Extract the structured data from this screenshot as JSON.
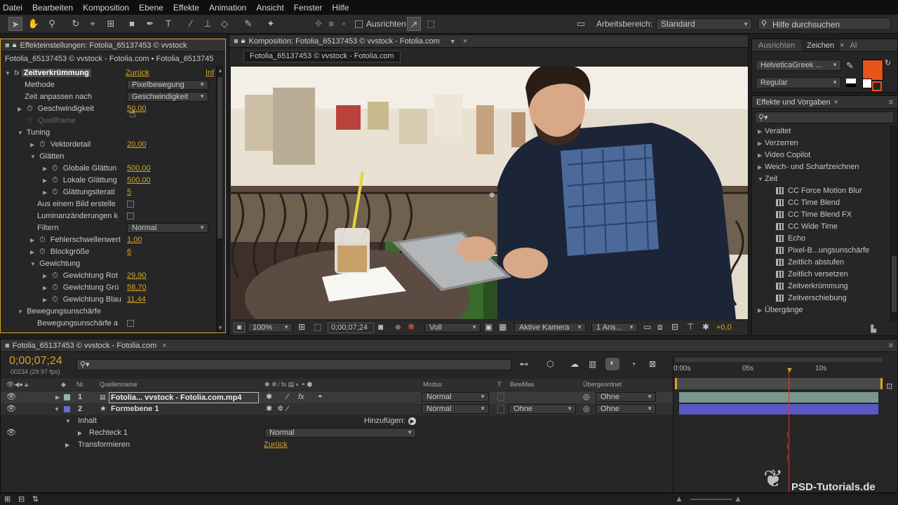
{
  "menu": [
    "Datei",
    "Bearbeiten",
    "Komposition",
    "Ebene",
    "Effekte",
    "Animation",
    "Ansicht",
    "Fenster",
    "Hilfe"
  ],
  "toolbar": {
    "ausrichten": "Ausrichten",
    "arbeitsbereich_label": "Arbeitsbereich:",
    "arbeitsbereich_value": "Standard",
    "search_placeholder": "Hilfe durchsuchen"
  },
  "effects_panel": {
    "tab": "Effekteinstellungen: Fotolia_65137453 © vvstock",
    "breadcrumb": "Fotolia_65137453 © vvstock - Fotolia.com • Fotolia_6513745",
    "effect_name": "Zeitverkrümmung",
    "reset": "Zurück",
    "info_cut": "Inf",
    "rows": [
      {
        "label": "Methode",
        "dd": "Pixelbewegung"
      },
      {
        "label": "Zeit anpassen nach",
        "dd": "Geschwindigkeit"
      },
      {
        "label": "Geschwindigkeit",
        "val": "50,00"
      },
      {
        "label": "Quellframe"
      },
      {
        "label": "Tuning"
      },
      {
        "label": "Vektordetail",
        "val": "20,00"
      },
      {
        "label": "Glätten"
      },
      {
        "label": "Globale Glättun",
        "val": "500,00"
      },
      {
        "label": "Lokale Glättung",
        "val": "500,00"
      },
      {
        "label": "Glättungsiterati",
        "val": "5"
      },
      {
        "label": "Aus einem Bild erstelle"
      },
      {
        "label": "Luminanzänderungen k"
      },
      {
        "label": "Filtern",
        "dd": "Normal"
      },
      {
        "label": "Fehlerschwellenwert",
        "val": "1,00"
      },
      {
        "label": "Blockgröße",
        "val": "6"
      },
      {
        "label": "Gewichtung"
      },
      {
        "label": "Gewichtung Rot",
        "val": "29,90"
      },
      {
        "label": "Gewichtung Grü",
        "val": "58,70"
      },
      {
        "label": "Gewichtung Blau",
        "val": "11,44"
      },
      {
        "label": "Bewegungsunschärfe"
      },
      {
        "label": "Bewegungsunschärfe a"
      }
    ]
  },
  "comp_panel": {
    "tab": "Komposition: Fotolia_65137453 © vvstock - Fotolia.com",
    "subtab": "Fotolia_65137453 © vvstock - Fotolia.com",
    "zoom": "100%",
    "timecode": "0;00;07;24",
    "resolution": "Voll",
    "camera": "Aktive Kamera",
    "views": "1 Ans...",
    "exposure": "+0,0"
  },
  "char_panel": {
    "tabs": [
      "Ausrichten",
      "Zeichen",
      "Al"
    ],
    "font": "HelveticaGreek ...",
    "style": "Regular",
    "fill_color": "#e8541a"
  },
  "effects_presets": {
    "tab": "Effekte und Vorgaben",
    "search_placeholder": "",
    "items": [
      {
        "label": "Veraltet",
        "type": "folder"
      },
      {
        "label": "Verzerren",
        "type": "folder"
      },
      {
        "label": "Video Copilot",
        "type": "folder"
      },
      {
        "label": "Weich- und Scharfzeichnen",
        "type": "folder"
      },
      {
        "label": "Zeit",
        "type": "folder-open"
      },
      {
        "label": "CC Force Motion Blur",
        "type": "effect"
      },
      {
        "label": "CC Time Blend",
        "type": "effect"
      },
      {
        "label": "CC Time Blend FX",
        "type": "effect"
      },
      {
        "label": "CC Wide Time",
        "type": "effect"
      },
      {
        "label": "Echo",
        "type": "effect"
      },
      {
        "label": "Pixel-B...ungsunschärfe",
        "type": "effect"
      },
      {
        "label": "Zeitlich abstufen",
        "type": "effect"
      },
      {
        "label": "Zeitlich versetzen",
        "type": "effect"
      },
      {
        "label": "Zeitverkrümmung",
        "type": "effect"
      },
      {
        "label": "Zeitverschiebung",
        "type": "effect"
      },
      {
        "label": "Übergänge",
        "type": "folder"
      }
    ]
  },
  "timeline": {
    "tab": "Fotolia_65137453 © vvstock - Fotolia.com",
    "timecode": "0;00;07;24",
    "frames": "00234 (29.97 fps)",
    "col_nr": "Nr.",
    "col_source": "Quellenname",
    "col_mode": "Modus",
    "col_t": "T",
    "col_bewmas": "BewMas",
    "col_parent": "Übergeordnet",
    "ruler": [
      "0:00s",
      "05s",
      "10s"
    ],
    "layers": [
      {
        "nr": "1",
        "name": "Fotolia... vvstock - Fotolia.com.mp4",
        "mode": "Normal",
        "parent": "Ohne",
        "color": "#8fb3a8"
      },
      {
        "nr": "2",
        "name": "Formebene 1",
        "mode": "Normal",
        "bewmas": "Ohne",
        "parent": "Ohne",
        "color": "#6a6ad0"
      }
    ],
    "inhalt": "Inhalt",
    "hinzufuegen": "Hinzufügen:",
    "rechteck": "Rechteck 1",
    "rechteck_mode": "Normal",
    "transformieren": "Transformieren",
    "zurueck": "Zurück"
  },
  "watermark": "PSD-Tutorials.de"
}
